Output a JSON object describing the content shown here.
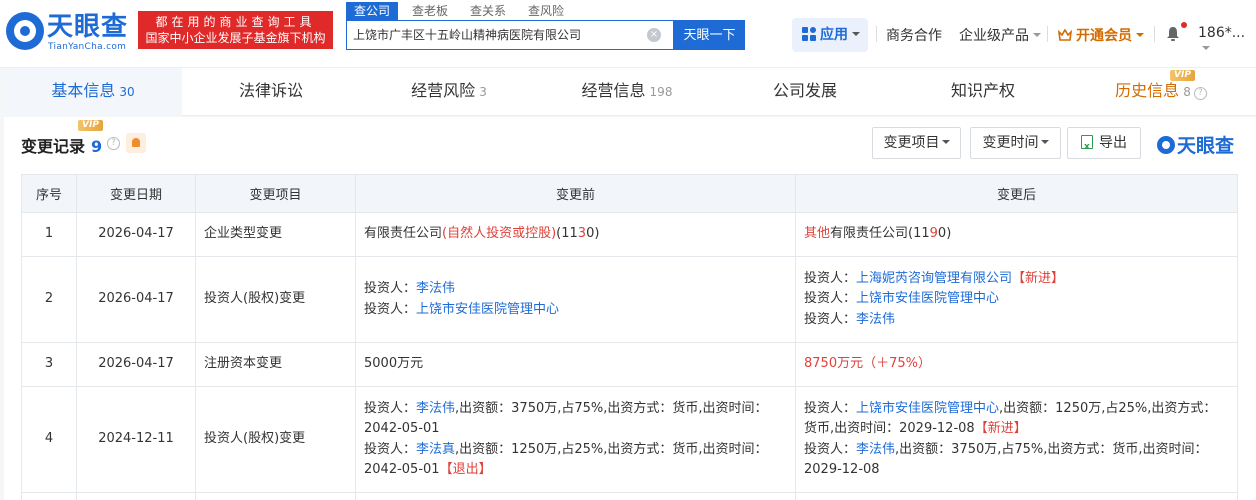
{
  "header": {
    "logo_text": "天眼查",
    "logo_sub": "TianYanCha.com",
    "slogan_line1": "都在用的商业查询工具",
    "slogan_line2": "国家中小企业发展子基金旗下机构",
    "search_tabs": [
      "查公司",
      "查老板",
      "查关系",
      "查风险"
    ],
    "search_value": "上饶市广丰区十五岭山精神病医院有限公司",
    "clear_symbol": "×",
    "search_button": "天眼一下",
    "app_label": "应用",
    "nav": {
      "business": "商务合作",
      "enterprise": "企业级产品",
      "vip": "开通会员",
      "user": "186*..."
    }
  },
  "tabs": [
    {
      "label": "基本信息",
      "count": "30"
    },
    {
      "label": "法律诉讼",
      "count": ""
    },
    {
      "label": "经营风险",
      "count": "3"
    },
    {
      "label": "经营信息",
      "count": "198"
    },
    {
      "label": "公司发展",
      "count": ""
    },
    {
      "label": "知识产权",
      "count": ""
    },
    {
      "label": "历史信息",
      "count": "8"
    }
  ],
  "vip_tag": "VIP",
  "help_symbol": "?",
  "section": {
    "title": "变更记录",
    "count": "9",
    "filter_item": "变更项目",
    "filter_time": "变更时间",
    "export": "导出",
    "brand": "天眼查"
  },
  "table": {
    "headers": [
      "序号",
      "变更日期",
      "变更项目",
      "变更前",
      "变更后"
    ],
    "rows": [
      {
        "idx": "1",
        "date": "2026-04-17",
        "item": "企业类型变更",
        "before": {
          "a": "有限责任公司",
          "b": "(自然人投资或控股)",
          "c": "(11",
          "d": "3",
          "e": "0)"
        },
        "after": {
          "a": "其他",
          "b": "有限责任公司(11",
          "c": "9",
          "d": "0)"
        }
      },
      {
        "idx": "2",
        "date": "2026-04-17",
        "item": "投资人(股权)变更",
        "before": {
          "label": "投资人：",
          "p1": "李法伟",
          "p2": "上饶市安佳医院管理中心"
        },
        "after": {
          "label": "投资人：",
          "p1": "上海妮芮咨询管理有限公司",
          "p1_tag": "【新进】",
          "p2": "上饶市安佳医院管理中心",
          "p3": "李法伟"
        }
      },
      {
        "idx": "3",
        "date": "2026-04-17",
        "item": "注册资本变更",
        "before": {
          "text": "5000万元"
        },
        "after": {
          "text": "8750万元（＋75%）"
        }
      },
      {
        "idx": "4",
        "date": "2024-12-11",
        "item": "投资人(股权)变更",
        "before": {
          "label": "投资人：",
          "p1": "李法伟",
          "p1_rest": ",出资额：3750万,占75%,出资方式：货币,出资时间：2042-05-01",
          "p2": "李法真",
          "p2_rest": ",出资额：1250万,占25%,出资方式：货币,出资时间：2042-05-01",
          "p2_tag": "【退出】"
        },
        "after": {
          "label": "投资人：",
          "p1": "上饶市安佳医院管理中心",
          "p1_rest": ",出资额：1250万,占25%,出资方式：货币,出资时间：2029-12-08",
          "p1_tag": "【新进】",
          "p2": "李法伟",
          "p2_rest": ",出资额：3750万,占75%,出资方式：货币,出资时间：2029-12-08"
        }
      }
    ]
  },
  "colors": {
    "brand_blue": "#1e6bd6",
    "alert_red": "#e02a2a",
    "vip_orange": "#d36b00"
  }
}
